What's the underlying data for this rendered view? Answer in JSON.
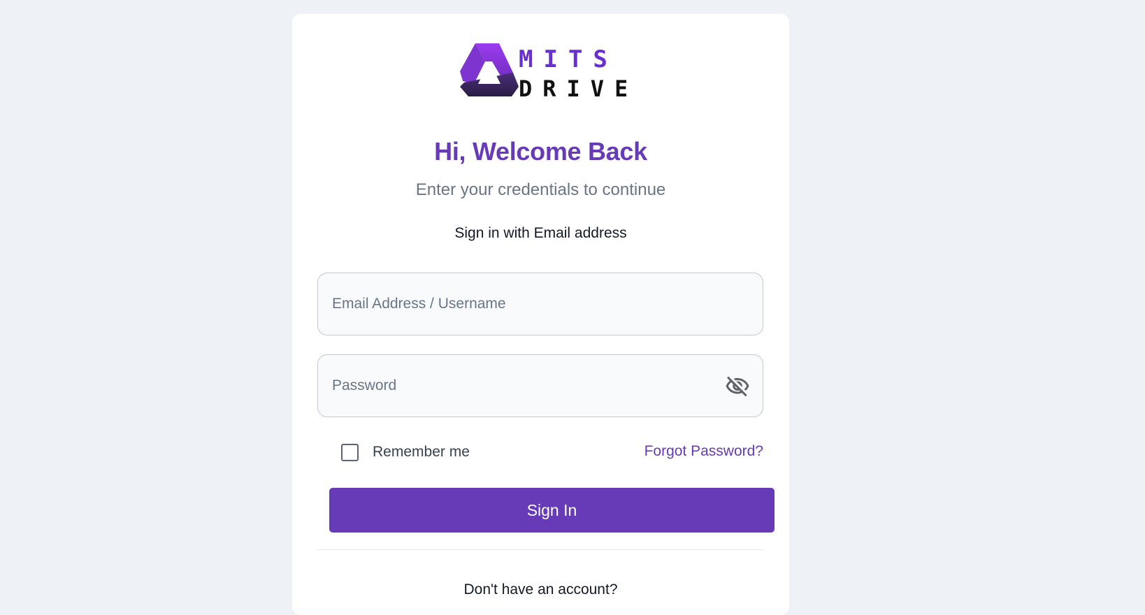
{
  "brand": {
    "logo_top": "MITS",
    "logo_bottom": "DRIVE",
    "accent_color": "#673ab7"
  },
  "login": {
    "title": "Hi, Welcome Back",
    "subtitle": "Enter your credentials to continue",
    "signin_with": "Sign in with Email address",
    "email_placeholder": "Email Address / Username",
    "password_placeholder": "Password",
    "remember_label": "Remember me",
    "remember_checked": false,
    "forgot_label": "Forgot Password?",
    "signin_label": "Sign In",
    "no_account_label": "Don't have an account?"
  },
  "icons": {
    "visibility_toggle": "eye-off-icon",
    "checkbox": "checkbox-unchecked-icon"
  }
}
